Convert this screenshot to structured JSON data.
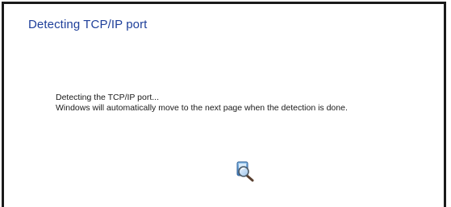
{
  "wizard": {
    "title": "Detecting TCP/IP port",
    "status_line_1": "Detecting the TCP/IP port...",
    "status_line_2": "Windows will automatically move to the next page when the detection is done."
  },
  "icons": {
    "search": "search-magnifier-icon"
  },
  "colors": {
    "title": "#1e3f9a",
    "text": "#1a1a1a",
    "border": "#1a1a1a",
    "background": "#ffffff"
  }
}
